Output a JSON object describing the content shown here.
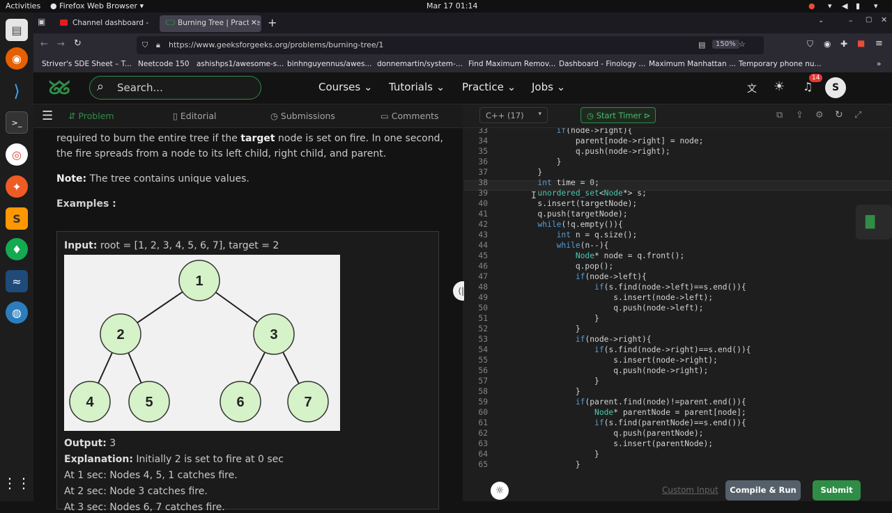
{
  "system": {
    "activities": "Activities",
    "app": "Firefox Web Browser",
    "datetime": "Mar 17  01:14"
  },
  "browser": {
    "tabs": [
      {
        "label": "Channel dashboard - You"
      },
      {
        "label": "Burning Tree | Practice | G"
      }
    ],
    "url": "https://www.geeksforgeeks.org/problems/burning-tree/1",
    "zoom": "150%",
    "bookmarks": [
      "Striver's SDE Sheet – T...",
      "Neetcode 150",
      "ashishps1/awesome-s...",
      "binhnguyennus/awes...",
      "donnemartin/system-...",
      "Find Maximum Remov...",
      "Dashboard - Finology ...",
      "Maximum Manhattan ...",
      "Temporary phone nu..."
    ]
  },
  "gfg": {
    "search_placeholder": "Search...",
    "nav": [
      "Courses",
      "Tutorials",
      "Practice",
      "Jobs"
    ],
    "notif_count": "14",
    "avatar": "S"
  },
  "left": {
    "tabs": [
      "Problem",
      "Editorial",
      "Submissions",
      "Comments"
    ],
    "para1_a": "required to burn the entire tree if the ",
    "para1_b": "target",
    "para1_c": " node is set on fire. In one second, the fire spreads from a node to its left child, right child, and parent.",
    "note_label": "Note:",
    "note_text": " The tree contains unique values.",
    "examples": "Examples :",
    "input_label": "Input:",
    "input_text": " root = [1, 2, 3, 4, 5, 6, 7], target = 2",
    "tree_nodes": [
      "1",
      "2",
      "3",
      "4",
      "5",
      "6",
      "7"
    ],
    "output_label": "Output:",
    "output_text": " 3",
    "expl_label": "Explanation:",
    "expl_text": " Initially 2 is set to fire at 0 sec",
    "expl_lines": [
      "At 1 sec: Nodes 4, 5, 1 catches fire.",
      "At 2 sec: Node 3 catches fire.",
      "At 3 sec: Nodes 6, 7 catches fire."
    ]
  },
  "editor": {
    "language": "C++ (17)",
    "timer": "Start Timer",
    "custom_input": "Custom Input",
    "compile": "Compile & Run",
    "submit": "Submit",
    "lines": [
      {
        "n": "33",
        "t": "            if(node->right){"
      },
      {
        "n": "34",
        "t": "                parent[node->right] = node;"
      },
      {
        "n": "35",
        "t": "                q.push(node->right);"
      },
      {
        "n": "36",
        "t": "            }"
      },
      {
        "n": "37",
        "t": "        }"
      },
      {
        "n": "38",
        "t": "        int time = 0;"
      },
      {
        "n": "39",
        "t": "        unordered_set<Node*> s;"
      },
      {
        "n": "40",
        "t": "        s.insert(targetNode);"
      },
      {
        "n": "41",
        "t": "        q.push(targetNode);"
      },
      {
        "n": "42",
        "t": "        while(!q.empty()){"
      },
      {
        "n": "43",
        "t": "            int n = q.size();"
      },
      {
        "n": "44",
        "t": "            while(n--){"
      },
      {
        "n": "45",
        "t": "                Node* node = q.front();"
      },
      {
        "n": "46",
        "t": "                q.pop();"
      },
      {
        "n": "47",
        "t": "                if(node->left){"
      },
      {
        "n": "48",
        "t": "                    if(s.find(node->left)==s.end()){"
      },
      {
        "n": "49",
        "t": "                        s.insert(node->left);"
      },
      {
        "n": "50",
        "t": "                        q.push(node->left);"
      },
      {
        "n": "51",
        "t": "                    }"
      },
      {
        "n": "52",
        "t": "                }"
      },
      {
        "n": "53",
        "t": "                if(node->right){"
      },
      {
        "n": "54",
        "t": "                    if(s.find(node->right)==s.end()){"
      },
      {
        "n": "55",
        "t": "                        s.insert(node->right);"
      },
      {
        "n": "56",
        "t": "                        q.push(node->right);"
      },
      {
        "n": "57",
        "t": "                    }"
      },
      {
        "n": "58",
        "t": "                }"
      },
      {
        "n": "59",
        "t": "                if(parent.find(node)!=parent.end()){"
      },
      {
        "n": "60",
        "t": "                    Node* parentNode = parent[node];"
      },
      {
        "n": "61",
        "t": "                    if(s.find(parentNode)==s.end()){"
      },
      {
        "n": "62",
        "t": "                        q.push(parentNode);"
      },
      {
        "n": "63",
        "t": "                        s.insert(parentNode);"
      },
      {
        "n": "64",
        "t": "                    }"
      },
      {
        "n": "65",
        "t": "                }"
      }
    ]
  },
  "colors": {
    "accent": "#2f8d46",
    "keyword": "#569cd6",
    "text": "#d4d4d4"
  }
}
